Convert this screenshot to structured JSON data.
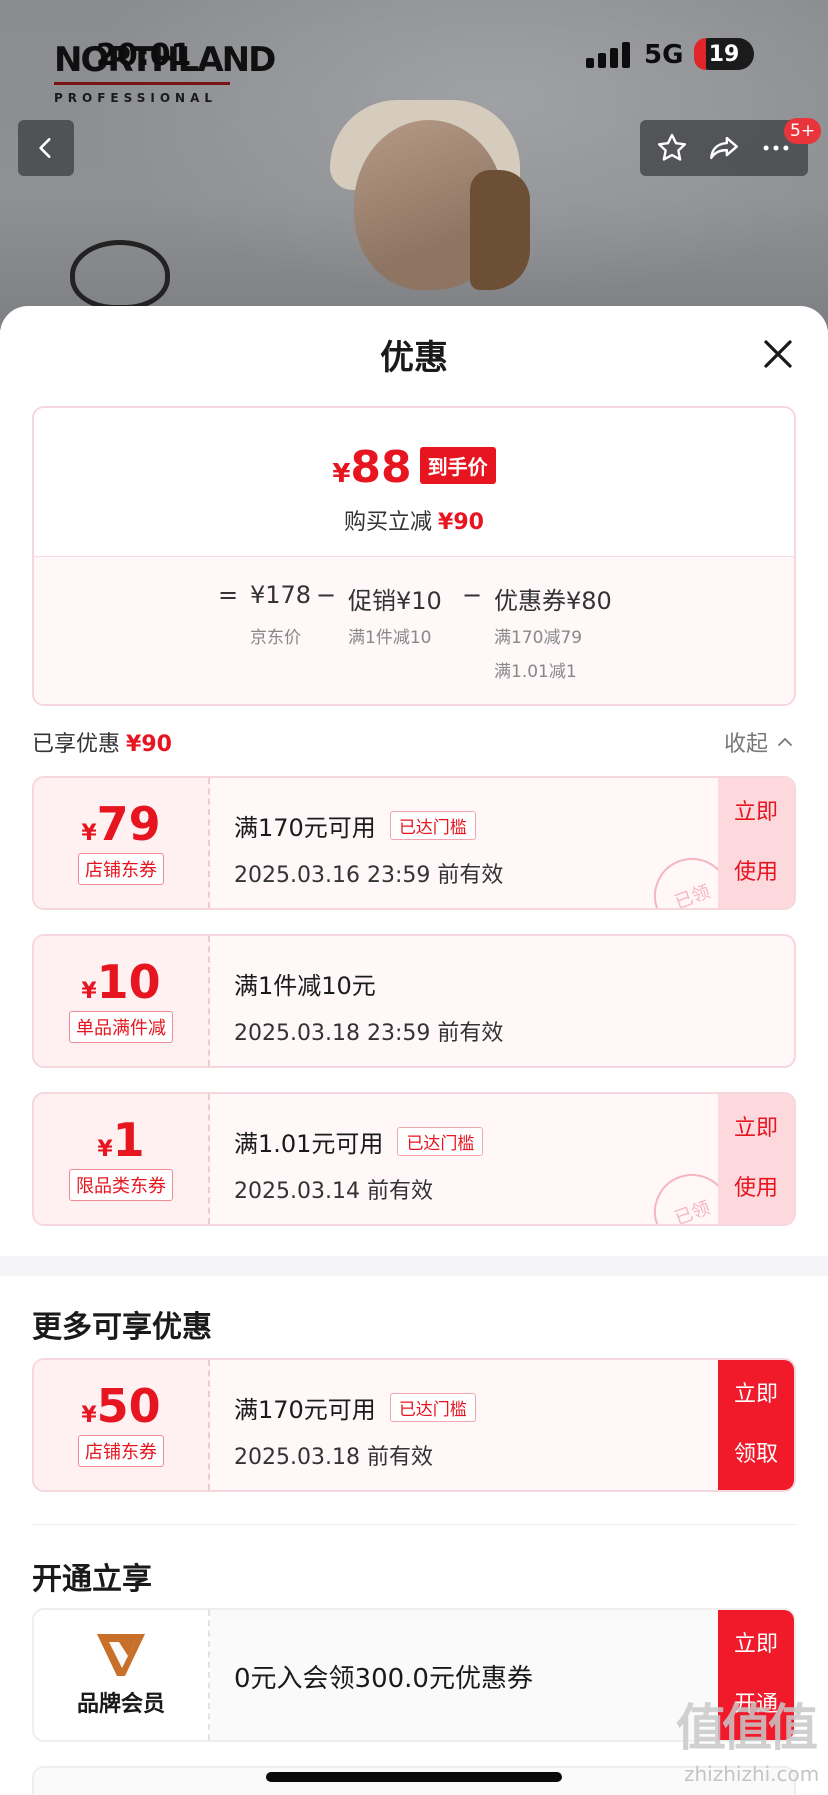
{
  "status_bar": {
    "time": "20:01",
    "network": "5G",
    "battery": "19"
  },
  "brand": {
    "name": "NORTHLAND",
    "subtitle": "PROFESSIONAL"
  },
  "header": {
    "badge": "5+",
    "icons": [
      "back-icon",
      "star-icon",
      "share-icon",
      "more-icon"
    ]
  },
  "sheet": {
    "title": "优惠"
  },
  "summary": {
    "currency": "¥",
    "final_price": "88",
    "final_label": "到手价",
    "save_label": "购买立减",
    "save_amount": "¥90",
    "formula": {
      "eq": "=",
      "jd_price": "¥178",
      "jd_label": "京东价",
      "minus1": "−",
      "promo": "促销¥10",
      "promo_sub": "满1件减10",
      "minus2": "−",
      "coupon": "优惠券¥80",
      "coupon_sub1": "满170减79",
      "coupon_sub2": "满1.01减1"
    }
  },
  "applied": {
    "label": "已享优惠",
    "amount": "¥90",
    "collapse": "收起"
  },
  "coupons": [
    {
      "currency": "¥",
      "amount": "79",
      "type": "店铺东券",
      "condition": "满170元可用",
      "tag": "已达门槛",
      "date": "2025.03.16 23:59 前有效",
      "button": "立即使用",
      "btn1": "立即",
      "btn2": "使用",
      "stamp": "已领"
    },
    {
      "currency": "¥",
      "amount": "10",
      "type": "单品满件减",
      "condition": "满1件减10元",
      "date": "2025.03.18 23:59 前有效"
    },
    {
      "currency": "¥",
      "amount": "1",
      "type": "限品类东券",
      "condition": "满1.01元可用",
      "tag": "已达门槛",
      "date": "2025.03.14 前有效",
      "btn1": "立即",
      "btn2": "使用",
      "stamp": "已领"
    }
  ],
  "more": {
    "title": "更多可享优惠",
    "coupon": {
      "currency": "¥",
      "amount": "50",
      "type": "店铺东券",
      "condition": "满170元可用",
      "tag": "已达门槛",
      "date": "2025.03.18 前有效",
      "btn1": "立即",
      "btn2": "领取"
    }
  },
  "member": {
    "title": "开通立享",
    "label": "品牌会员",
    "text": "0元入会领300.0元优惠券",
    "btn1": "立即",
    "btn2": "开通"
  },
  "watermark": {
    "main": "值值值",
    "sub": "zhizhizhi.com"
  },
  "colors": {
    "accent": "#e6151f",
    "coupon_bg": "#fff7f8",
    "coupon_border": "#f7d7de"
  }
}
